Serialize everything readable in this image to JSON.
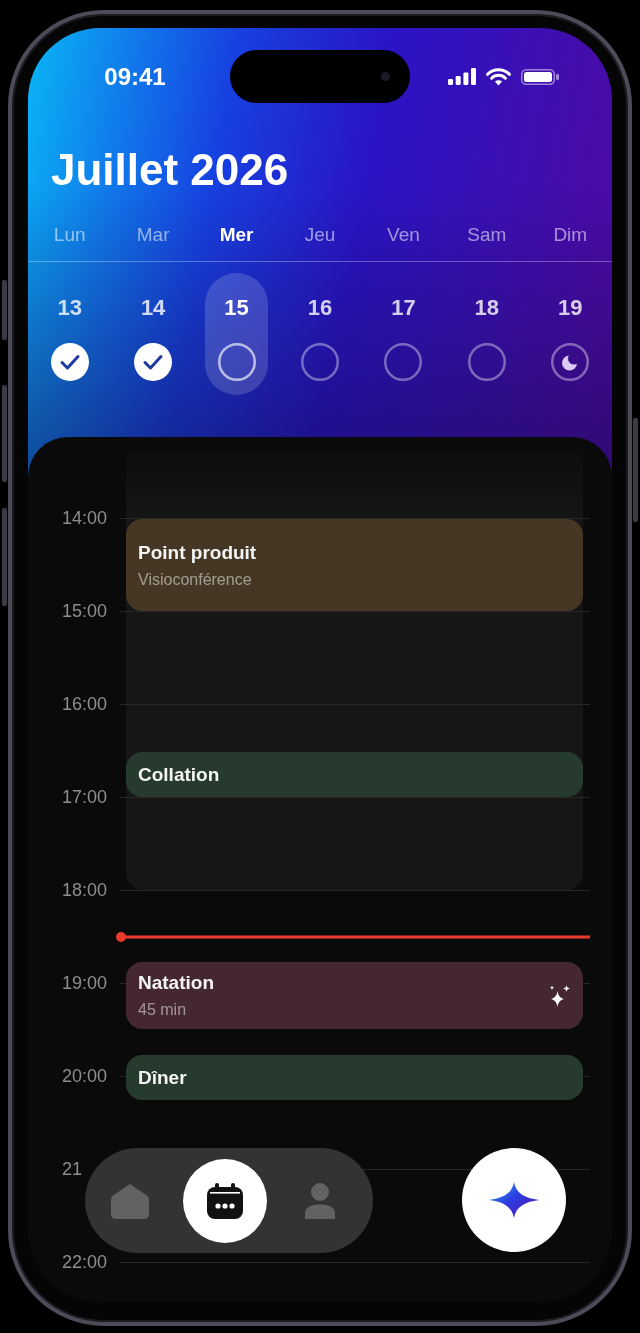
{
  "status_bar": {
    "time": "09:41"
  },
  "header": {
    "title": "Juillet 2026"
  },
  "week": [
    {
      "weekday": "Lun",
      "date": "13",
      "selected": false,
      "kind": "habit",
      "checked": true
    },
    {
      "weekday": "Mar",
      "date": "14",
      "selected": false,
      "kind": "habit",
      "checked": true
    },
    {
      "weekday": "Mer",
      "date": "15",
      "selected": true,
      "kind": "habit",
      "checked": false
    },
    {
      "weekday": "Jeu",
      "date": "16",
      "selected": false,
      "kind": "habit",
      "checked": false
    },
    {
      "weekday": "Ven",
      "date": "17",
      "selected": false,
      "kind": "habit",
      "checked": false
    },
    {
      "weekday": "Sam",
      "date": "18",
      "selected": false,
      "kind": "habit",
      "checked": false
    },
    {
      "weekday": "Dim",
      "date": "19",
      "selected": false,
      "kind": "rest",
      "checked": false
    }
  ],
  "timeline": {
    "hours": [
      "14:00",
      "15:00",
      "16:00",
      "17:00",
      "18:00",
      "19:00",
      "20:00",
      "21",
      "22:00"
    ],
    "events": [
      {
        "title": "Point produit",
        "subtitle": "Visioconférence",
        "color": "#453724",
        "sparkle": false
      },
      {
        "title": "Collation",
        "color": "#263b2d",
        "sparkle": false
      },
      {
        "title": "Natation",
        "subtitle": "45 min",
        "color": "#45272f",
        "sparkle": true
      },
      {
        "title": "Dîner",
        "color": "#263b2d",
        "sparkle": false
      }
    ]
  },
  "nav": {
    "tabs": [
      {
        "kind": "home",
        "selected": false
      },
      {
        "kind": "calendar",
        "selected": true
      },
      {
        "kind": "profile",
        "selected": false
      }
    ]
  }
}
